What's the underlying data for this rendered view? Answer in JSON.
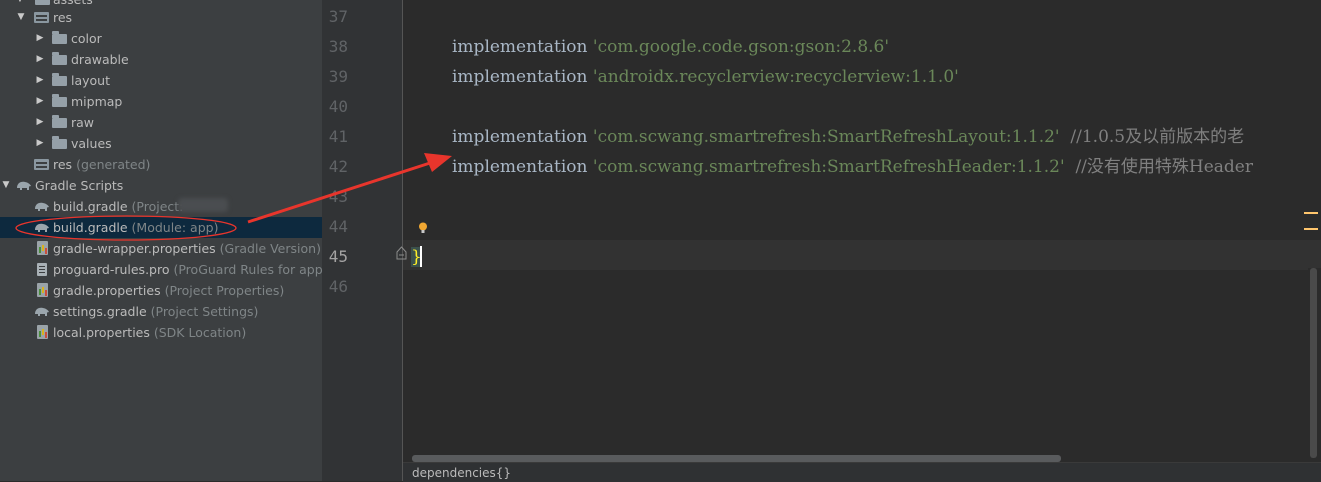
{
  "tree": {
    "items": [
      {
        "label": "assets",
        "hint": ""
      },
      {
        "label": "res",
        "hint": ""
      },
      {
        "label": "color",
        "hint": ""
      },
      {
        "label": "drawable",
        "hint": ""
      },
      {
        "label": "layout",
        "hint": ""
      },
      {
        "label": "mipmap",
        "hint": ""
      },
      {
        "label": "raw",
        "hint": ""
      },
      {
        "label": "values",
        "hint": ""
      },
      {
        "label": "res",
        "hint": "(generated)"
      },
      {
        "label": "Gradle Scripts",
        "hint": ""
      },
      {
        "label": "build.gradle",
        "hint": "(Project:"
      },
      {
        "label": "build.gradle",
        "hint": "(Module: app)"
      },
      {
        "label": "gradle-wrapper.properties",
        "hint": "(Gradle Version)"
      },
      {
        "label": "proguard-rules.pro",
        "hint": "(ProGuard Rules for app)"
      },
      {
        "label": "gradle.properties",
        "hint": "(Project Properties)"
      },
      {
        "label": "settings.gradle",
        "hint": "(Project Settings)"
      },
      {
        "label": "local.properties",
        "hint": "(SDK Location)"
      }
    ]
  },
  "editor": {
    "line_numbers": [
      "37",
      "38",
      "39",
      "40",
      "41",
      "42",
      "43",
      "44",
      "45",
      "46"
    ],
    "current_line": "45",
    "lines": [
      {
        "kw": "implementation ",
        "str": "'com.google.code.gson:gson:2.8.6'",
        "cmt": ""
      },
      {
        "kw": "implementation ",
        "str": "'androidx.recyclerview:recyclerview:1.1.0'",
        "cmt": ""
      },
      {
        "kw": "implementation ",
        "str": "'com.scwang.smartrefresh:SmartRefreshLayout:1.1.2'",
        "cmt": "  //1.0.5及以前版本的老"
      },
      {
        "kw": "implementation ",
        "str": "'com.scwang.smartrefresh:SmartRefreshHeader:1.1.2'",
        "cmt": "  //没有使用特殊Header"
      }
    ],
    "closing_brace": "}",
    "breadcrumb": "dependencies{}"
  },
  "colors": {
    "tree_bg": "#3c3f41",
    "editor_bg": "#2b2b2b",
    "selection": "#0d293e",
    "string": "#6a8759",
    "comment": "#808080",
    "annotation": "#e8352c"
  }
}
